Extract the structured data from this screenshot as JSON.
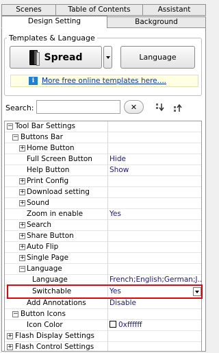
{
  "tabs": {
    "scenes": "Scenes",
    "toc": "Table of Contents",
    "assistant": "Assistant",
    "design": "Design Setting",
    "background": "Background"
  },
  "templates": {
    "legend": "Templates & Language",
    "spread_label": "Spread",
    "language_label": "Language",
    "more_link": "More free online templates here....",
    "info_icon": "i"
  },
  "search": {
    "label": "Search:",
    "value": "",
    "clear_icon": "✕"
  },
  "tree": [
    {
      "name": "Tool Bar Settings",
      "value": "",
      "expander": "−"
    },
    {
      "name": "Buttons Bar",
      "value": "",
      "expander": "−"
    },
    {
      "name": "Home Button",
      "value": "",
      "expander": "+"
    },
    {
      "name": "Full Screen Button",
      "value": "Hide",
      "expander": ""
    },
    {
      "name": "Help Button",
      "value": "Show",
      "expander": ""
    },
    {
      "name": "Print Config",
      "value": "",
      "expander": "+"
    },
    {
      "name": "Download setting",
      "value": "",
      "expander": "+"
    },
    {
      "name": "Sound",
      "value": "",
      "expander": "+"
    },
    {
      "name": "Zoom in enable",
      "value": "Yes",
      "expander": ""
    },
    {
      "name": "Search",
      "value": "",
      "expander": "+"
    },
    {
      "name": "Share Button",
      "value": "",
      "expander": "+"
    },
    {
      "name": "Auto Flip",
      "value": "",
      "expander": "+"
    },
    {
      "name": "Single Page",
      "value": "",
      "expander": "+"
    },
    {
      "name": "Language",
      "value": "",
      "expander": "−"
    },
    {
      "name": "Language",
      "value": "French;English;German;J...",
      "expander": ""
    },
    {
      "name": "Switchable",
      "value": "Yes",
      "expander": ""
    },
    {
      "name": "Add Annotations",
      "value": "Disable",
      "expander": ""
    },
    {
      "name": "Button Icons",
      "value": "",
      "expander": "−"
    },
    {
      "name": "Icon Color",
      "value": "0xffffff",
      "expander": ""
    },
    {
      "name": "Flash Display Settings",
      "value": "",
      "expander": "+"
    },
    {
      "name": "Flash Control Settings",
      "value": "",
      "expander": "+"
    }
  ],
  "colors": {
    "highlight": "#e8000b",
    "value_text": "#1a1a8c",
    "link": "#0033cc"
  }
}
